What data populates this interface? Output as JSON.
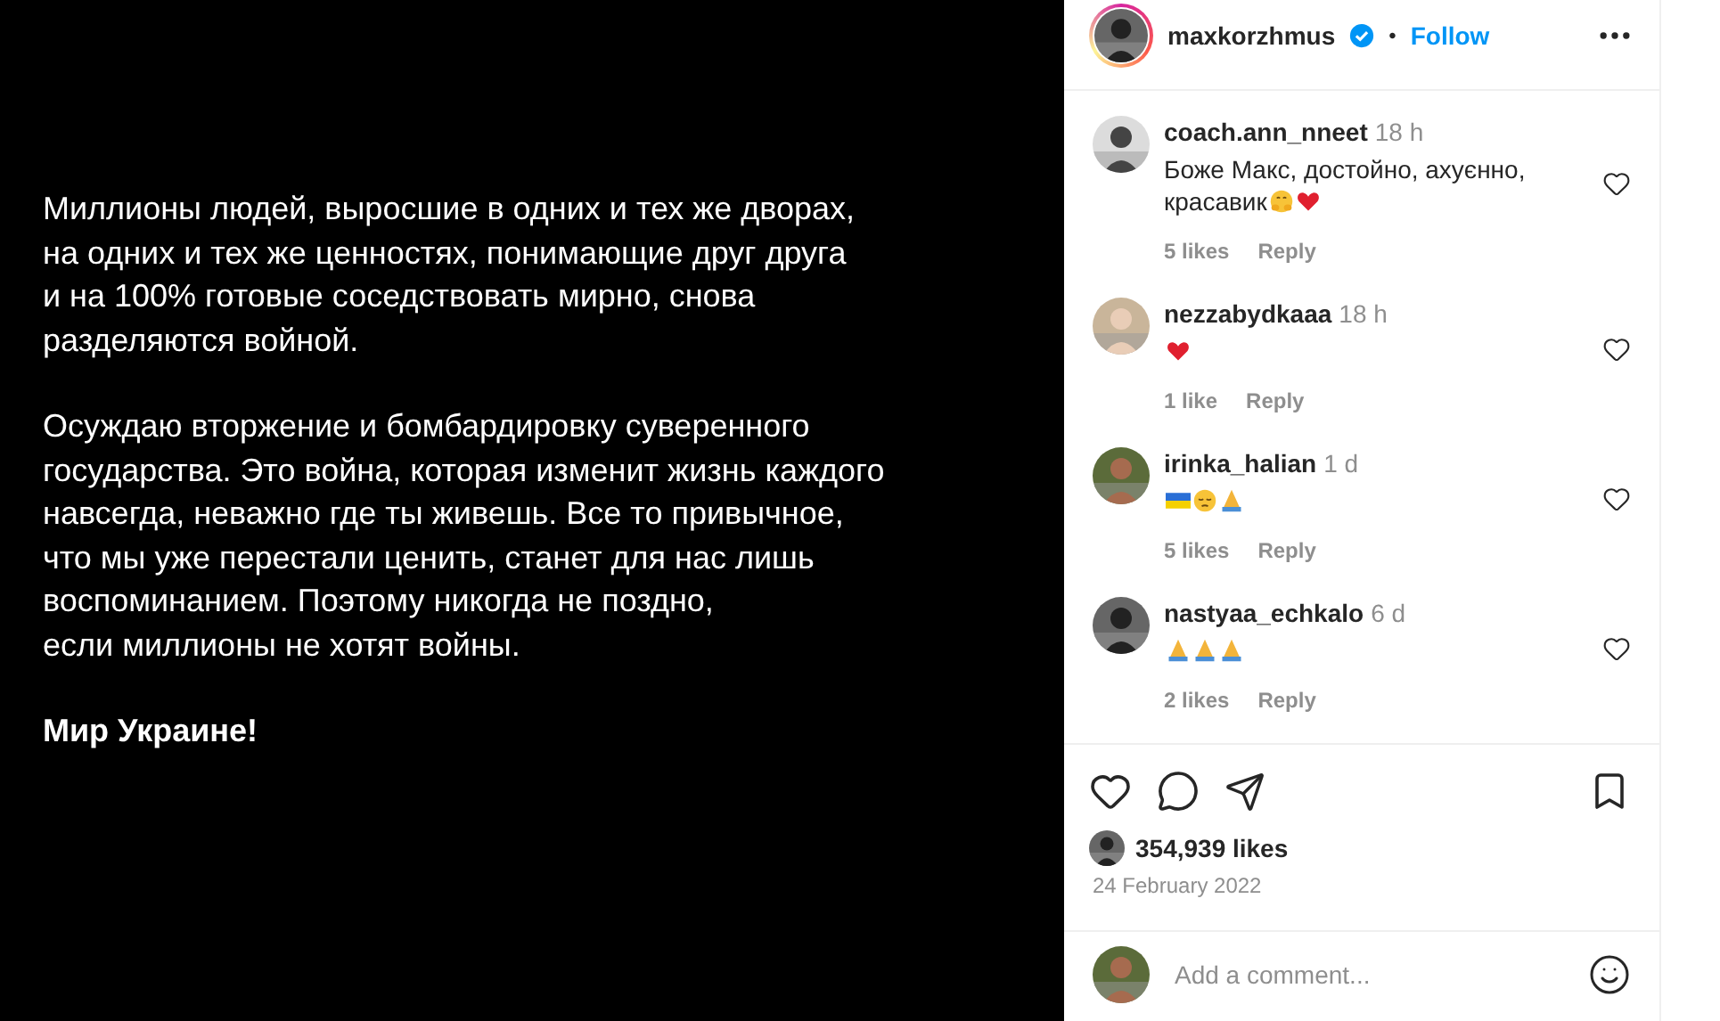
{
  "post_text": {
    "paragraphs": [
      {
        "text": "Миллионы людей, выросшие в одних и тех же дворах,\nна одних и тех же ценностях, понимающие друг друга\nи на 100% готовые соседствовать мирно, снова\nразделяются войной.",
        "bold": false
      },
      {
        "text": "Осуждаю вторжение и бомбардировку суверенного\nгосударства. Это война, которая изменит жизнь каждого\nнавсегда, неважно где ты живешь. Все то привычное,\nчто мы уже перестали ценить, станет для нас лишь\nвоспоминанием. Поэтому никогда не поздно,\nесли миллионы не хотят войны.",
        "bold": false
      },
      {
        "text": "Мир Украине!",
        "bold": true
      }
    ]
  },
  "header": {
    "username": "maxkorzhmus",
    "verified": true,
    "separator": "•",
    "follow": "Follow"
  },
  "comments": [
    {
      "user": "coach.ann_nneet",
      "time": "18 h",
      "text": "Боже Макс, достойно, ахуєнно, красавик",
      "emoji": [
        {
          "kind": "hug"
        },
        {
          "kind": "heart"
        }
      ],
      "likes": "5 likes",
      "reply": "Reply"
    },
    {
      "user": "nezzabydkaaa",
      "time": "18 h",
      "emoji": [
        {
          "kind": "heart"
        }
      ],
      "likes": "1 like",
      "reply": "Reply"
    },
    {
      "user": "irinka_halian",
      "time": "1 d",
      "emoji": [
        {
          "kind": "flag"
        },
        {
          "kind": "pensive"
        },
        {
          "kind": "pray"
        }
      ],
      "likes": "5 likes",
      "reply": "Reply"
    },
    {
      "user": "nastyaa_echkalo",
      "time": "6 d",
      "emoji": [
        {
          "kind": "pray"
        },
        {
          "kind": "pray"
        },
        {
          "kind": "pray"
        }
      ],
      "likes": "2 likes",
      "reply": "Reply"
    }
  ],
  "likes": "354,939 likes",
  "date": "24 February 2022",
  "add_comment": {
    "placeholder": "Add a comment..."
  }
}
